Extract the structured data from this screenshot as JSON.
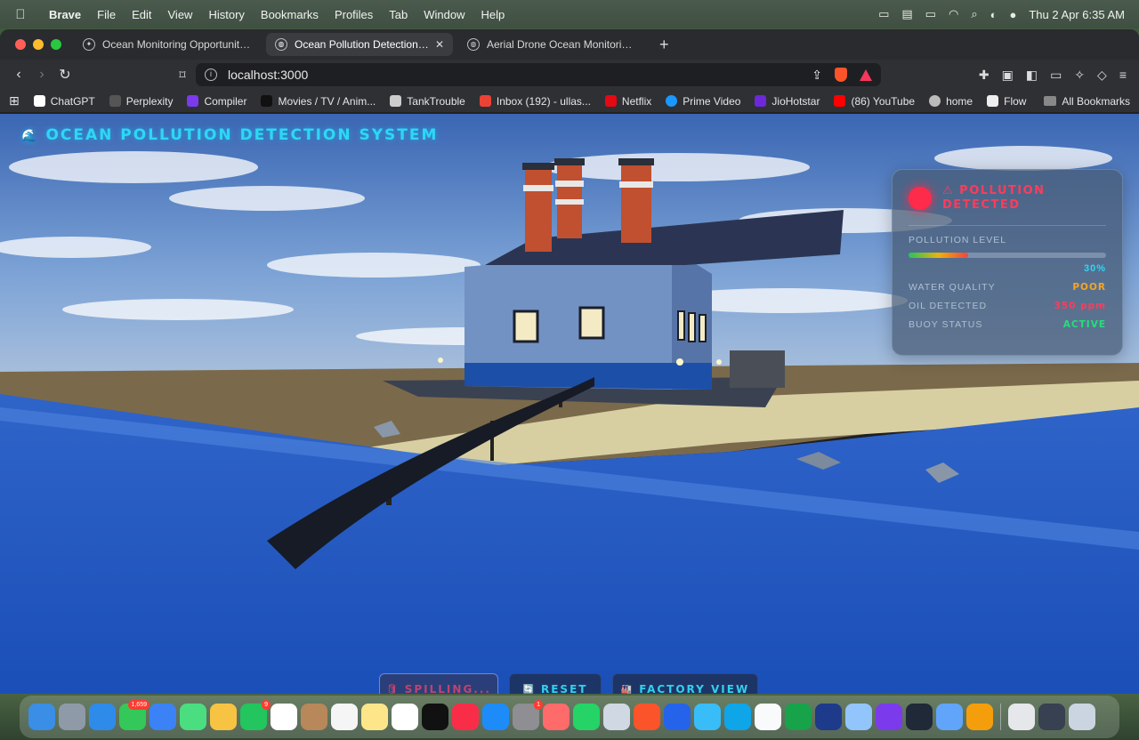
{
  "menubar": {
    "app": "Brave",
    "items": [
      "File",
      "Edit",
      "View",
      "History",
      "Bookmarks",
      "Profiles",
      "Tab",
      "Window",
      "Help"
    ],
    "clock": "Thu 2 Apr  6:35 AM"
  },
  "tabs": [
    {
      "title": "Ocean Monitoring Opportunities",
      "active": false
    },
    {
      "title": "Ocean Pollution Detection Sim",
      "active": true
    },
    {
      "title": "Aerial Drone Ocean Monitoring | U/",
      "active": false
    }
  ],
  "url": "localhost:3000",
  "bookmarks": [
    {
      "label": "ChatGPT",
      "color": "#ffffff"
    },
    {
      "label": "Perplexity",
      "color": "#1f1f1f"
    },
    {
      "label": "Compiler",
      "color": "#7c3aed"
    },
    {
      "label": "Movies / TV / Anim...",
      "color": "#111111"
    },
    {
      "label": "TankTrouble",
      "color": "#333333"
    },
    {
      "label": "Inbox (192) - ullas...",
      "color": "#ea4335"
    },
    {
      "label": "Netflix",
      "color": "#e50914"
    },
    {
      "label": "Prime Video",
      "color": "#1a98ff"
    },
    {
      "label": "JioHotstar",
      "color": "#6d28d9"
    },
    {
      "label": "(86) YouTube",
      "color": "#ff0000"
    },
    {
      "label": "home",
      "color": "#bbbbbb"
    },
    {
      "label": "Flow",
      "color": "#eeeeee"
    }
  ],
  "all_bookmarks": "All Bookmarks",
  "app": {
    "title": "OCEAN POLLUTION DETECTION SYSTEM",
    "title_icon": "🌊",
    "status": {
      "alert": "⚠ POLLUTION DETECTED",
      "pollution_label": "POLLUTION LEVEL",
      "pollution_level": 0.3,
      "pollution_value": "30%",
      "water_quality_label": "WATER QUALITY",
      "water_quality": "POOR",
      "oil_label": "OIL DETECTED",
      "oil": "350 ppm",
      "buoy_label": "BUOY STATUS",
      "buoy": "ACTIVE"
    },
    "controls": {
      "spill": "SPILLING...",
      "spill_icon": "🛢",
      "reset": "RESET",
      "reset_icon": "🔄",
      "factory": "FACTORY VIEW",
      "factory_icon": "🏭"
    }
  },
  "dock": {
    "icons": [
      {
        "name": "finder",
        "color": "#3a8ee6"
      },
      {
        "name": "launchpad",
        "color": "#8f9aa8"
      },
      {
        "name": "safari",
        "color": "#2e8bea"
      },
      {
        "name": "messages",
        "color": "#34c759",
        "badge": "1,659"
      },
      {
        "name": "mail",
        "color": "#3b82f6"
      },
      {
        "name": "maps",
        "color": "#4ade80"
      },
      {
        "name": "photos",
        "color": "#f6c343"
      },
      {
        "name": "facetime",
        "color": "#22c55e",
        "badge": "9"
      },
      {
        "name": "calendar",
        "color": "#ffffff"
      },
      {
        "name": "contacts",
        "color": "#b8875a"
      },
      {
        "name": "reminders",
        "color": "#f5f5f5"
      },
      {
        "name": "notes",
        "color": "#fde68a"
      },
      {
        "name": "freeform",
        "color": "#ffffff"
      },
      {
        "name": "tv",
        "color": "#111111"
      },
      {
        "name": "music",
        "color": "#fa2d48"
      },
      {
        "name": "app-store",
        "color": "#1d8cf8"
      },
      {
        "name": "system-settings",
        "color": "#8e8e93",
        "badge": "1"
      },
      {
        "name": "iphone-mirroring",
        "color": "#ff6b6b"
      },
      {
        "name": "whatsapp",
        "color": "#25d366"
      },
      {
        "name": "quicktime",
        "color": "#cfd8e3"
      },
      {
        "name": "brave",
        "color": "#fb542b"
      },
      {
        "name": "copilot",
        "color": "#2563eb"
      },
      {
        "name": "butterfly",
        "color": "#38bdf8"
      },
      {
        "name": "vscode",
        "color": "#0ea5e9"
      },
      {
        "name": "textedit",
        "color": "#f8fafc"
      },
      {
        "name": "excel",
        "color": "#16a34a"
      },
      {
        "name": "xcode-instruments",
        "color": "#1e3a8a"
      },
      {
        "name": "preview",
        "color": "#93c5fd"
      },
      {
        "name": "arc",
        "color": "#7c3aed"
      },
      {
        "name": "terminal",
        "color": "#1f2937"
      },
      {
        "name": "passwords",
        "color": "#60a5fa"
      },
      {
        "name": "chrome",
        "color": "#f59e0b"
      },
      {
        "name": "document",
        "color": "#e5e7eb"
      },
      {
        "name": "screenshots",
        "color": "#374151"
      },
      {
        "name": "trash",
        "color": "#cbd5e1"
      }
    ]
  }
}
